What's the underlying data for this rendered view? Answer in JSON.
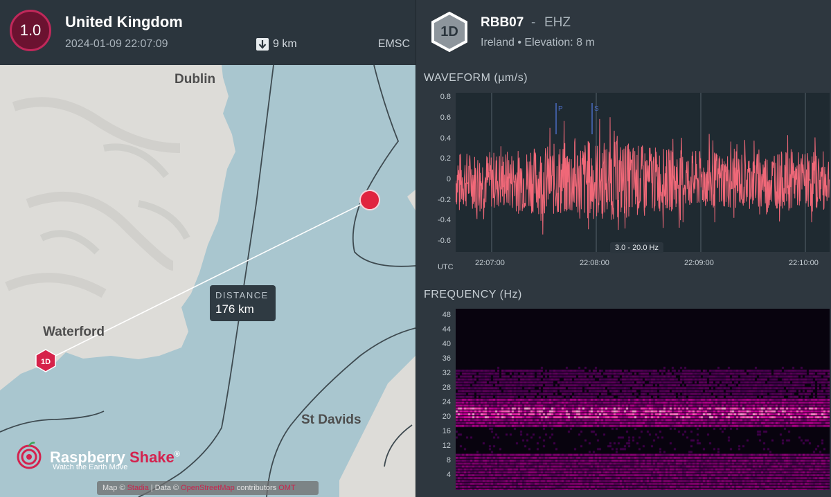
{
  "event": {
    "magnitude": "1.0",
    "region": "United Kingdom",
    "datetime": "2024-01-09 22:07:09",
    "depth": "9 km",
    "source": "EMSC",
    "accent_color": "#c0285a"
  },
  "map": {
    "cities": [
      "Dublin",
      "Waterford",
      "St Davids"
    ],
    "distance_label": "DISTANCE",
    "distance_value": "176 km",
    "station_marker": "1D",
    "brand": {
      "name_part1": "Raspberry ",
      "name_part2": "Shake",
      "registered": "®",
      "tagline": "Watch the Earth Move"
    },
    "attribution": {
      "map": "Map ©",
      "map_link": "Stadia",
      "data": "| Data ©",
      "data_link": "OpenStreetMap",
      "contributors": "contributors",
      "extra_link": "OMT"
    }
  },
  "station": {
    "badge": "1D",
    "code": "RBB07",
    "separator": "-",
    "channel": "EHZ",
    "location": "Ireland • Elevation: 8 m"
  },
  "waveform": {
    "title": "WAVEFORM  (µm/s)",
    "filter": "3.0 - 20.0 Hz",
    "tz": "UTC",
    "phase_p": "P",
    "phase_s": "S",
    "trace_color": "#f06878"
  },
  "frequency": {
    "title": "FREQUENCY  (Hz)"
  },
  "chart_data": [
    {
      "type": "line",
      "title": "WAVEFORM (µm/s)",
      "xlabel": "UTC",
      "ylabel": "µm/s",
      "ylim": [
        -0.7,
        0.85
      ],
      "yticks": [
        0.8,
        0.6,
        0.4,
        0.2,
        0,
        -0.2,
        -0.4,
        -0.6
      ],
      "ytick_labels": [
        "0.8",
        "0.6",
        "0.4",
        "0.2",
        "0",
        "-0.2",
        "-0.4",
        "-0.6"
      ],
      "xticks": [
        "22:07:00",
        "22:08:00",
        "22:09:00",
        "22:10:00"
      ],
      "phase_markers": [
        {
          "name": "P",
          "time": "22:07:38"
        },
        {
          "name": "S",
          "time": "22:07:58"
        }
      ],
      "grid": true
    },
    {
      "type": "heatmap",
      "title": "FREQUENCY (Hz)",
      "ylabel": "Hz",
      "ylim": [
        0,
        50
      ],
      "yticks": [
        48,
        44,
        40,
        36,
        32,
        28,
        24,
        20,
        16,
        12,
        8,
        4
      ],
      "ytick_labels": [
        "48",
        "44",
        "40",
        "36",
        "32",
        "28",
        "24",
        "20",
        "16",
        "12",
        "8",
        "4"
      ],
      "dominant_band_hz": 21
    }
  ]
}
